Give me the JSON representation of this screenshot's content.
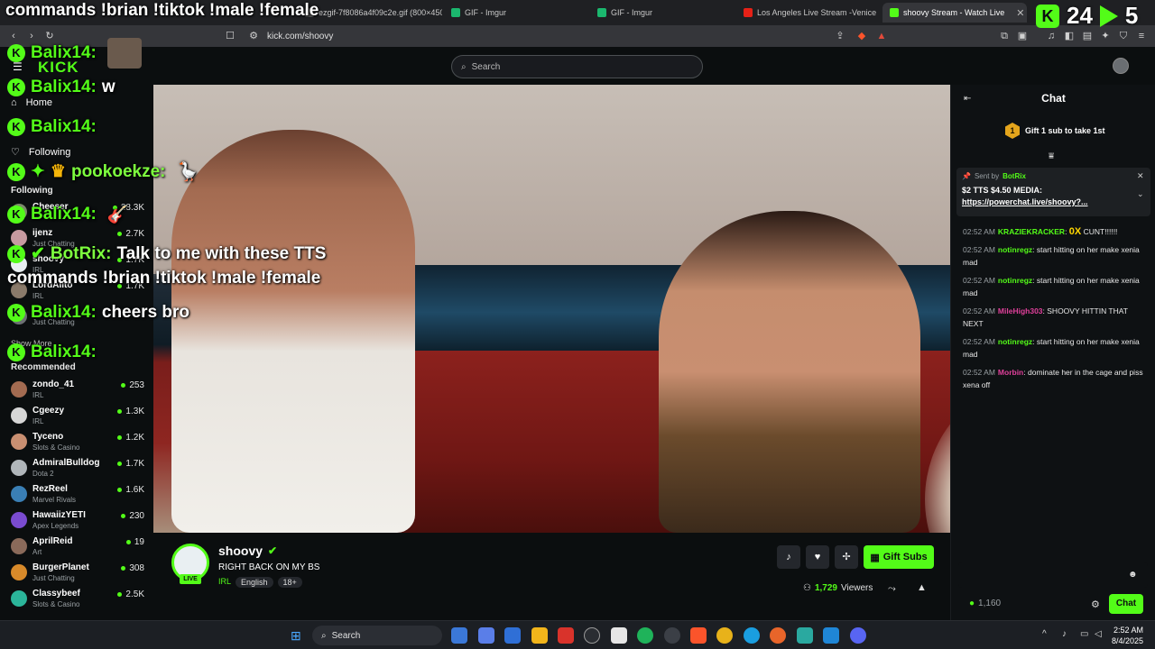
{
  "browser": {
    "tabs": [
      {
        "label": "ezgif-7f8086a4f09c2e.gif (800×450)",
        "color": "#3a3a3a"
      },
      {
        "label": "GIF - Imgur",
        "color": "#1bb76e"
      },
      {
        "label": "GIF - Imgur",
        "color": "#1bb76e"
      },
      {
        "label": "Los Angeles Live Stream -Venice",
        "color": "#e62117"
      },
      {
        "label": "shoovy Stream - Watch Live",
        "color": "#53fc18"
      }
    ],
    "url": "kick.com/shoovy"
  },
  "site": {
    "logo": "KICK",
    "search_placeholder": "Search",
    "nav": {
      "home": "Home",
      "following": "Following"
    },
    "following_title": "Following",
    "following": [
      {
        "name": "Cheeser",
        "category": "",
        "viewers": "28.3K",
        "color": "#7c8a6a"
      },
      {
        "name": "ijenz",
        "category": "Just Chatting",
        "viewers": "2.7K",
        "color": "#c79aa0"
      },
      {
        "name": "shoovy",
        "category": "IRL",
        "viewers": "1.7K",
        "color": "#e9eff2"
      },
      {
        "name": "LordAlito",
        "category": "IRL",
        "viewers": "1.7K",
        "color": "#8a7a6a"
      },
      {
        "name": "",
        "category": "Just Chatting",
        "viewers": "",
        "color": "#6c6f73"
      }
    ],
    "show_more": "Show More",
    "recommended_title": "Recommended",
    "recommended": [
      {
        "name": "zondo_41",
        "category": "IRL",
        "viewers": "253",
        "color": "#a36b51"
      },
      {
        "name": "Cgeezy",
        "category": "IRL",
        "viewers": "1.3K",
        "color": "#d6d6d6"
      },
      {
        "name": "Tyceno",
        "category": "Slots & Casino",
        "viewers": "1.2K",
        "color": "#c98f71"
      },
      {
        "name": "AdmiralBulldog",
        "category": "Dota 2",
        "viewers": "1.7K",
        "color": "#b0b6ba"
      },
      {
        "name": "RezReel",
        "category": "Marvel Rivals",
        "viewers": "1.6K",
        "color": "#3a7fb5"
      },
      {
        "name": "HawaiizYETI",
        "category": "Apex Legends",
        "viewers": "230",
        "color": "#7a4bd0"
      },
      {
        "name": "AprilReid",
        "category": "Art",
        "viewers": "19",
        "color": "#8a6a5a"
      },
      {
        "name": "BurgerPlanet",
        "category": "Just Chatting",
        "viewers": "308",
        "color": "#d88a2a"
      },
      {
        "name": "Classybeef",
        "category": "Slots & Casino",
        "viewers": "2.5K",
        "color": "#2bb59a"
      }
    ]
  },
  "stream": {
    "live_badge": "LIVE",
    "streamer": "shoovy",
    "title": "RIGHT BACK ON MY BS",
    "category": "IRL",
    "tags": [
      "English",
      "18+"
    ],
    "gift_label": "Gift Subs",
    "viewers": "1,729",
    "viewers_label": "Viewers"
  },
  "chat": {
    "title": "Chat",
    "gift_num": "1",
    "gift_text": "Gift 1 sub to take 1st",
    "pinned": {
      "sent_by": "Sent by",
      "bot": "BotRix",
      "message": "$2 TTS $4.50 MEDIA:",
      "link": "https://powerchat.live/shoovy?..."
    },
    "messages": [
      {
        "time": "02:52 AM",
        "user": "KRAZIEKRACKER",
        "color": "#53fc18",
        "text": "CUNT!!!!!!",
        "emote": "0X"
      },
      {
        "time": "02:52 AM",
        "user": "notinregz",
        "color": "#53fc18",
        "text": "start hitting on her make xenia mad",
        "emote": ""
      },
      {
        "time": "02:52 AM",
        "user": "notinregz",
        "color": "#53fc18",
        "text": "start hitting on her make xenia mad",
        "emote": ""
      },
      {
        "time": "02:52 AM",
        "user": "MileHigh303",
        "color": "#e0409b",
        "text": "SHOOVY HITTIN THAT NEXT",
        "emote": ""
      },
      {
        "time": "02:52 AM",
        "user": "notinregz",
        "color": "#53fc18",
        "text": "start hitting on her make xenia mad",
        "emote": ""
      },
      {
        "time": "02:52 AM",
        "user": "Morbin",
        "color": "#e0409b",
        "text": "dominate her in the cage and piss xena off",
        "emote": ""
      }
    ],
    "points": "1,160",
    "send_label": "Chat"
  },
  "overlay": {
    "top_text": "commands !brian !tiktok !male !female",
    "score": [
      "24",
      "5"
    ],
    "lines": [
      {
        "user": "Balix14:",
        "text": ""
      },
      {
        "user": "Balix14:",
        "text": "w"
      },
      {
        "user": "Balix14:",
        "text": ""
      },
      {
        "user": "pookoekze:",
        "text": ""
      },
      {
        "user": "Balix14:",
        "text": ""
      },
      {
        "user": "BotRix:",
        "text": "Talk to me with these TTS"
      },
      {
        "user": "",
        "text": "commands !brian !tiktok !male !female"
      },
      {
        "user": "Balix14:",
        "text": "cheers bro"
      },
      {
        "user": "Balix14:",
        "text": ""
      }
    ]
  },
  "taskbar": {
    "search": "Search",
    "time": "2:52 AM",
    "date": "8/4/2025"
  }
}
